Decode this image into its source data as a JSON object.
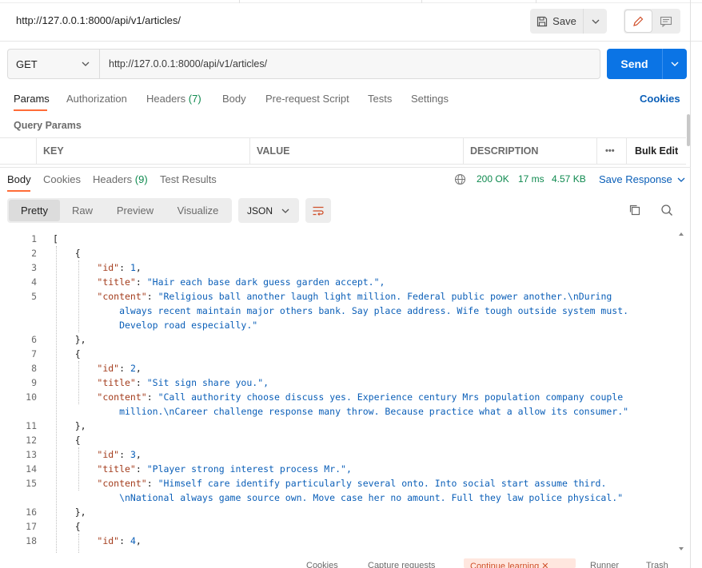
{
  "request": {
    "title": "http://127.0.0.1:8000/api/v1/articles/",
    "save_label": "Save",
    "method": "GET",
    "url": "http://127.0.0.1:8000/api/v1/articles/",
    "send_label": "Send"
  },
  "req_tabs": {
    "params": "Params",
    "authorization": "Authorization",
    "headers": "Headers",
    "headers_count": "(7)",
    "body": "Body",
    "prerequest": "Pre-request Script",
    "tests": "Tests",
    "settings": "Settings",
    "cookies": "Cookies"
  },
  "query_params": {
    "title": "Query Params",
    "columns": [
      "KEY",
      "VALUE",
      "DESCRIPTION"
    ],
    "more": "•••",
    "bulk_edit": "Bulk Edit"
  },
  "response": {
    "tabs": {
      "body": "Body",
      "cookies": "Cookies",
      "headers": "Headers",
      "headers_count": "(9)",
      "test_results": "Test Results"
    },
    "status": "200 OK",
    "time": "17 ms",
    "size": "4.57 KB",
    "save_response": "Save Response",
    "formats": [
      "Pretty",
      "Raw",
      "Preview",
      "Visualize"
    ],
    "language": "JSON"
  },
  "code_lines": [
    {
      "n": "1",
      "t": "["
    },
    {
      "n": "2",
      "t": "    {"
    },
    {
      "n": "3",
      "t": "        \"id\": 1,"
    },
    {
      "n": "4",
      "t": "        \"title\": \"Hair each base dark guess garden accept.\","
    },
    {
      "n": "5",
      "t": "        \"content\": \"Religious ball another laugh light million. Federal public power another.\\nDuring"
    },
    {
      "n": "",
      "t": "            always recent maintain major others bank. Say place address. Wife tough outside system must."
    },
    {
      "n": "",
      "t": "            Develop road especially.\""
    },
    {
      "n": "6",
      "t": "    },"
    },
    {
      "n": "7",
      "t": "    {"
    },
    {
      "n": "8",
      "t": "        \"id\": 2,"
    },
    {
      "n": "9",
      "t": "        \"title\": \"Sit sign share you.\","
    },
    {
      "n": "10",
      "t": "        \"content\": \"Call authority choose discuss yes. Experience century Mrs population company couple"
    },
    {
      "n": "",
      "t": "            million.\\nCareer challenge response many throw. Because practice what a allow its consumer.\""
    },
    {
      "n": "11",
      "t": "    },"
    },
    {
      "n": "12",
      "t": "    {"
    },
    {
      "n": "13",
      "t": "        \"id\": 3,"
    },
    {
      "n": "14",
      "t": "        \"title\": \"Player strong interest process Mr.\","
    },
    {
      "n": "15",
      "t": "        \"content\": \"Himself care identify particularly several onto. Into social start assume third."
    },
    {
      "n": "",
      "t": "            \\nNational always game source own. Move case her no amount. Full they law police physical.\""
    },
    {
      "n": "16",
      "t": "    },"
    },
    {
      "n": "17",
      "t": "    {"
    },
    {
      "n": "18",
      "t": "        \"id\": 4,"
    }
  ],
  "footer": {
    "cookies": "Cookies",
    "capture": "Capture requests",
    "learning": "Continue learning",
    "runner": "Runner",
    "trash": "Trash"
  },
  "colors": {
    "accent": "#ff6c37",
    "send": "#0b74e5",
    "link": "#0b5fb8",
    "status_ok": "#0f8a4f",
    "json_key": "#a33c1c",
    "json_value": "#0b5fb8"
  }
}
